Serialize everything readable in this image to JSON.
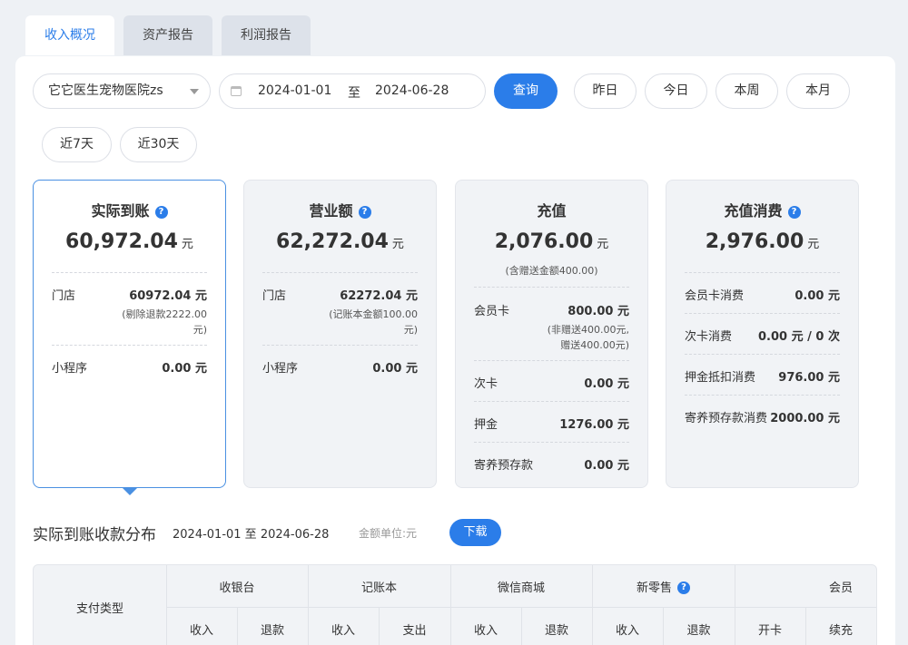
{
  "tabs": [
    "收入概况",
    "资产报告",
    "利润报告"
  ],
  "filters": {
    "clinic": "它它医生宠物医院zs",
    "date_start": "2024-01-01",
    "date_sep": "至",
    "date_end": "2024-06-28",
    "query_label": "查询",
    "quick": [
      "昨日",
      "今日",
      "本周",
      "本月",
      "近7天",
      "近30天"
    ]
  },
  "cards": {
    "actual": {
      "title": "实际到账",
      "amount": "60,972.04",
      "unit": "元",
      "rows": [
        {
          "label": "门店",
          "value": "60972.04 元",
          "note1": "(剔除退款2222.00",
          "note2": "元)"
        },
        {
          "label": "小程序",
          "value": "0.00 元"
        }
      ]
    },
    "revenue": {
      "title": "营业额",
      "amount": "62,272.04",
      "unit": "元",
      "rows": [
        {
          "label": "门店",
          "value": "62272.04 元",
          "note1": "(记账本金额100.00",
          "note2": "元)"
        },
        {
          "label": "小程序",
          "value": "0.00 元"
        }
      ]
    },
    "recharge": {
      "title": "充值",
      "amount": "2,076.00",
      "unit": "元",
      "sub": "(含赠送金额400.00)",
      "rows": [
        {
          "label": "会员卡",
          "value": "800.00 元",
          "note1": "(非赠送400.00元,",
          "note2": "赠送400.00元)"
        },
        {
          "label": "次卡",
          "value": "0.00 元"
        },
        {
          "label": "押金",
          "value": "1276.00 元"
        },
        {
          "label": "寄养预存款",
          "value": "0.00 元"
        }
      ]
    },
    "consume": {
      "title": "充值消费",
      "amount": "2,976.00",
      "unit": "元",
      "rows": [
        {
          "label": "会员卡消费",
          "value": "0.00 元"
        },
        {
          "label": "次卡消费",
          "value": "0.00 元 / 0 次"
        },
        {
          "label": "押金抵扣消费",
          "value": "976.00 元"
        },
        {
          "label": "寄养预存款消费",
          "value": "2000.00 元"
        }
      ]
    }
  },
  "section": {
    "title": "实际到账收款分布",
    "range": "2024-01-01 至 2024-06-28",
    "unit": "金额单位:元",
    "download": "下载"
  },
  "table": {
    "pay_type": "支付类型",
    "groups": [
      "收银台",
      "记账本",
      "微信商城",
      "新零售",
      "会员"
    ],
    "subheaders": [
      "收入",
      "退款",
      "收入",
      "支出",
      "收入",
      "退款",
      "收入",
      "退款",
      "开卡",
      "续充"
    ]
  }
}
